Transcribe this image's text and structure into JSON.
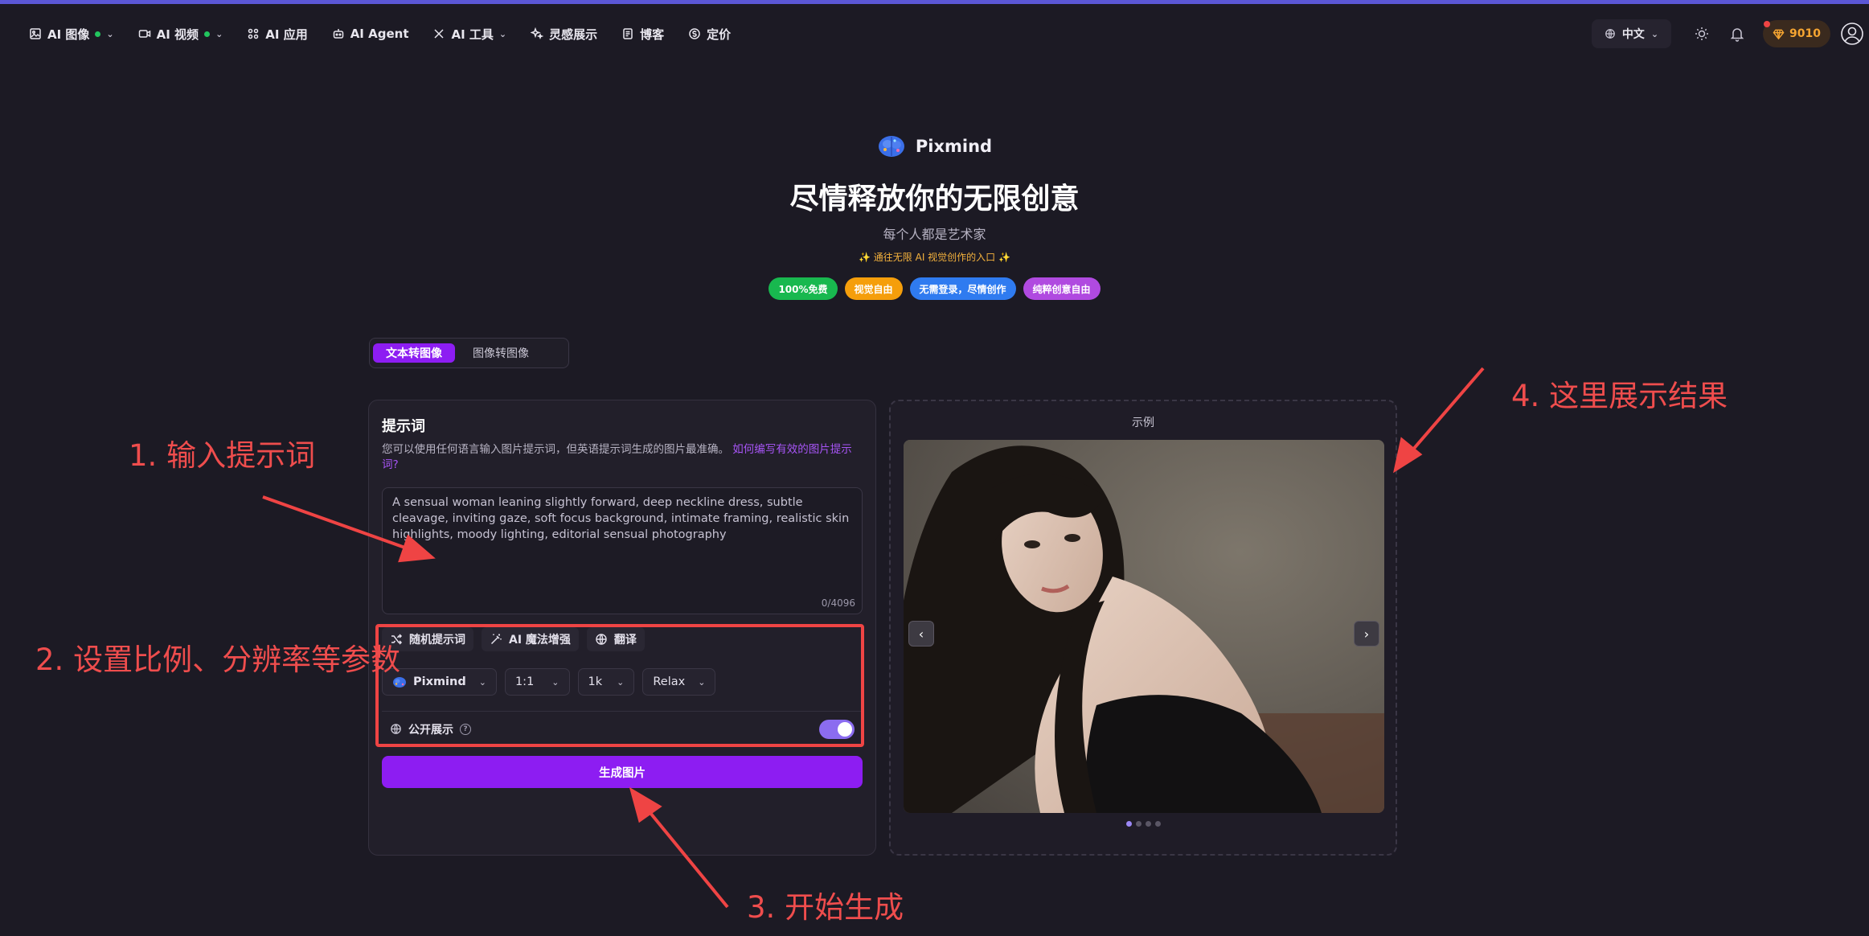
{
  "nav": {
    "items": [
      {
        "label": "AI 图像",
        "icon": "image-icon",
        "dot": true,
        "chevron": true
      },
      {
        "label": "AI 视频",
        "icon": "video-icon",
        "dot": true,
        "chevron": true
      },
      {
        "label": "AI 应用",
        "icon": "apps-icon",
        "dot": false,
        "chevron": false
      },
      {
        "label": "AI Agent",
        "icon": "robot-icon",
        "dot": false,
        "chevron": false
      },
      {
        "label": "AI 工具",
        "icon": "tools-icon",
        "dot": false,
        "chevron": true
      },
      {
        "label": "灵感展示",
        "icon": "sparkle-icon",
        "dot": false,
        "chevron": false
      },
      {
        "label": "博客",
        "icon": "blog-icon",
        "dot": false,
        "chevron": false
      },
      {
        "label": "定价",
        "icon": "price-icon",
        "dot": false,
        "chevron": false
      }
    ],
    "language": "中文",
    "points": "9010"
  },
  "hero": {
    "brand": "Pixmind",
    "title": "尽情释放你的无限创意",
    "subtitle": "每个人都是艺术家",
    "tagline": "✨ 通往无限 AI 视觉创作的入口 ✨",
    "badges": [
      {
        "label": "100%免费",
        "color": "#18b84f"
      },
      {
        "label": "视觉自由",
        "color": "#f59e0b"
      },
      {
        "label": "无需登录，尽情创作",
        "color": "#2f7bf0"
      },
      {
        "label": "纯粹创意自由",
        "color": "#b04ae0"
      }
    ]
  },
  "mode_tabs": {
    "text_to_image": "文本转图像",
    "image_to_image": "图像转图像"
  },
  "prompt_panel": {
    "title": "提示词",
    "desc": "您可以使用任何语言输入图片提示词，但英语提示词生成的图片最准确。",
    "link": "如何编写有效的图片提示词?",
    "prompt_text": "A sensual woman leaning slightly forward, deep neckline dress, subtle cleavage, inviting gaze, soft focus background, intimate framing, realistic skin highlights, moody lighting, editorial sensual photography",
    "counter": "0/4096",
    "tools": {
      "random": "随机提示词",
      "magic": "AI 魔法增强",
      "translate": "翻译"
    },
    "selects": {
      "model": "Pixmind",
      "ratio": "1:1",
      "resolution": "1k",
      "mode": "Relax"
    },
    "public_label": "公开展示",
    "public_on": true,
    "generate": "生成图片"
  },
  "preview_panel": {
    "label": "示例",
    "slide_index": 1,
    "slide_count": 4
  },
  "annotations": {
    "step1": "1. 输入提示词",
    "step2": "2. 设置比例、分辨率等参数",
    "step3": "3. 开始生成",
    "step4": "4. 这里展示结果",
    "color": "#ef4444"
  }
}
